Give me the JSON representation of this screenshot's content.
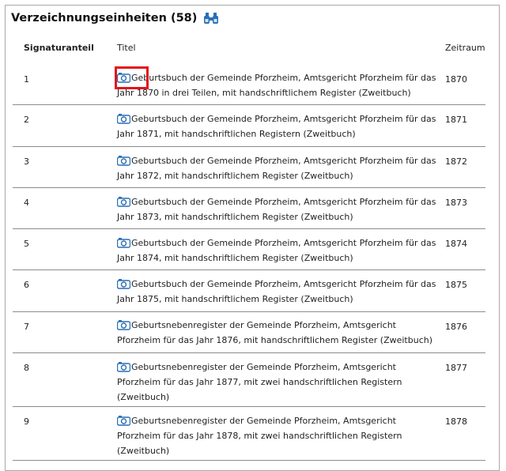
{
  "section": {
    "heading": "Verzeichnungseinheiten (58)",
    "heading_icon": "binoculars-icon"
  },
  "table": {
    "columns": {
      "signatur": "Signaturanteil",
      "titel": "Titel",
      "zeitraum": "Zeitraum"
    },
    "title_icon": "camera-icon",
    "rows": [
      {
        "signatur": "1",
        "titel_line1": "Geburtsbuch der Gemeinde Pforzheim, Amtsgericht Pforzheim für das",
        "titel_line2": "Jahr 1870 in drei Teilen, mit handschriftlichem Register (Zweitbuch)",
        "titel_line3": "",
        "zeitraum": "1870"
      },
      {
        "signatur": "2",
        "titel_line1": "Geburtsbuch der Gemeinde Pforzheim, Amtsgericht Pforzheim für das",
        "titel_line2": "Jahr 1871, mit handschriftlichen Registern (Zweitbuch)",
        "titel_line3": "",
        "zeitraum": "1871"
      },
      {
        "signatur": "3",
        "titel_line1": "Geburtsbuch der Gemeinde Pforzheim, Amtsgericht Pforzheim für das",
        "titel_line2": "Jahr 1872, mit handschriftlichem Register (Zweitbuch)",
        "titel_line3": "",
        "zeitraum": "1872"
      },
      {
        "signatur": "4",
        "titel_line1": "Geburtsbuch der Gemeinde Pforzheim, Amtsgericht Pforzheim für das",
        "titel_line2": "Jahr 1873, mit handschriftlichem Register (Zweitbuch)",
        "titel_line3": "",
        "zeitraum": "1873"
      },
      {
        "signatur": "5",
        "titel_line1": "Geburtsbuch der Gemeinde Pforzheim, Amtsgericht Pforzheim für das",
        "titel_line2": "Jahr 1874, mit handschriftlichem Register (Zweitbuch)",
        "titel_line3": "",
        "zeitraum": "1874"
      },
      {
        "signatur": "6",
        "titel_line1": "Geburtsbuch der Gemeinde Pforzheim, Amtsgericht Pforzheim für das",
        "titel_line2": "Jahr 1875, mit handschriftlichem Register (Zweitbuch)",
        "titel_line3": "",
        "zeitraum": "1875"
      },
      {
        "signatur": "7",
        "titel_line1": "Geburtsnebenregister der Gemeinde Pforzheim, Amtsgericht",
        "titel_line2": "Pforzheim für das Jahr 1876, mit handschriftlichem Register (Zweitbuch)",
        "titel_line3": "",
        "zeitraum": "1876"
      },
      {
        "signatur": "8",
        "titel_line1": "Geburtsnebenregister der Gemeinde Pforzheim, Amtsgericht",
        "titel_line2": "Pforzheim für das Jahr 1877, mit zwei handschriftlichen Registern",
        "titel_line3": "(Zweitbuch)",
        "zeitraum": "1877"
      },
      {
        "signatur": "9",
        "titel_line1": "Geburtsnebenregister der Gemeinde Pforzheim, Amtsgericht",
        "titel_line2": "Pforzheim für das Jahr 1878, mit zwei handschriftlichen Registern",
        "titel_line3": "(Zweitbuch)",
        "zeitraum": "1878"
      }
    ]
  },
  "colors": {
    "highlight": "#e3141c",
    "icon": "#2a6fb5",
    "divider": "#8c8c8c"
  }
}
